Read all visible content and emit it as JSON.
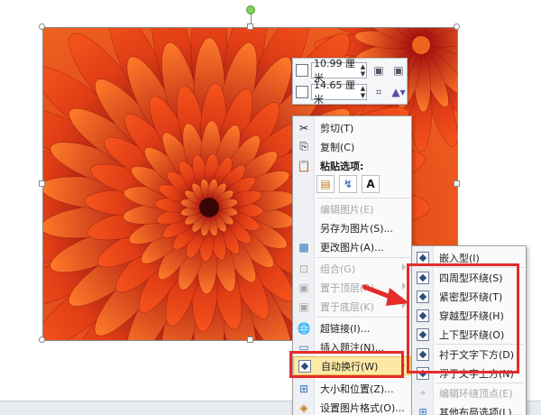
{
  "colors": {
    "accent_red": "#e52b2b",
    "highlight": "#fde9a4",
    "flower_dark": "#8e1010",
    "flower_light": "#f6541c"
  },
  "size_toolbar": {
    "height_value": "10.99 厘米",
    "width_value": "14.65 厘米",
    "height_icon": "shape-height-icon",
    "width_icon": "shape-width-icon",
    "crop_icon": "crop-icon",
    "style_icon": "picture-style-icon"
  },
  "context_menu": {
    "cut": "剪切(T)",
    "copy": "复制(C)",
    "paste_options": "粘贴选项:",
    "paste_text_option": "A",
    "edit_picture": "编辑图片(E)",
    "save_as_picture": "另存为图片(S)...",
    "change_picture": "更改图片(A)...",
    "group": "组合(G)",
    "bring_to_front": "置于顶层(R)",
    "send_to_back": "置于底层(K)",
    "hyperlink": "超链接(I)...",
    "insert_caption": "插入题注(N)...",
    "wrap_text": "自动换行(W)",
    "size_position": "大小和位置(Z)...",
    "format_picture": "设置图片格式(O)..."
  },
  "wrap_submenu": {
    "inline": "嵌入型(I)",
    "square": "四周型环绕(S)",
    "tight": "紧密型环绕(T)",
    "through": "穿越型环绕(H)",
    "top_bottom": "上下型环绕(O)",
    "behind_text": "衬于文字下方(D)",
    "in_front_text": "浮于文字上方(N)",
    "edit_wrap_points": "编辑环绕顶点(E)",
    "more_layout": "其他布局选项(L)..."
  }
}
